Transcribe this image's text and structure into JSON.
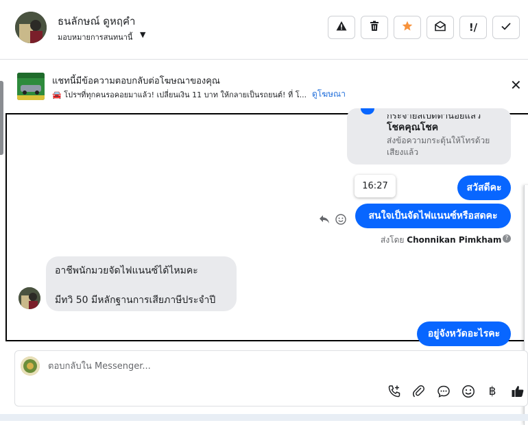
{
  "header": {
    "contact_name": "ธนลักษณ์ ดูหฤคำ",
    "assign_label": "มอบหมายการสนทนานี้",
    "buttons": [
      {
        "name": "spam-button",
        "icon": "warning-icon"
      },
      {
        "name": "delete-button",
        "icon": "trash-icon"
      },
      {
        "name": "star-button",
        "icon": "star-icon"
      },
      {
        "name": "mark-unread-button",
        "icon": "envelope-open-icon"
      },
      {
        "name": "follow-up-button",
        "icon": "double-exclamation-icon"
      },
      {
        "name": "done-button",
        "icon": "check-icon"
      }
    ]
  },
  "ad_banner": {
    "title": "แชทนี้มีข้อความตอบกลับต่อโฆษณาของคุณ",
    "description": "🚘 โปรฯที่ทุกคนรอคอยมาแล้ว! เปลี่ยนเงิน 11 บาท ให้กลายเป็นรถยนต์! ที่ โ...",
    "link": "ดูโฆษณา"
  },
  "chat": {
    "previous_card": {
      "line1": "กระจายสเปิดตำน้อยแล้ว",
      "line2": "โชคคุณโชค",
      "line3": "ส่งข้อความกระตุ้นให้โทรด้วย",
      "line4": "เสียงแล้ว"
    },
    "time_tooltip": "16:27",
    "outgoing": [
      "สวัสดีคะ",
      "สนใจเป็นจัดไฟแนนซ์หรือสดคะ",
      "อยู่จังหวัดอะไรคะ"
    ],
    "sent_by_prefix": "ส่งโดย",
    "sent_by_name": "Chonnikan Pimkham",
    "incoming": {
      "line1": "อาชีพนักมวยจัดไฟแนนซ์ได้ไหมคะ",
      "line2": "มีทวิ 50  มีหลักฐานการเสียภาษีประจำปี"
    }
  },
  "composer": {
    "placeholder": "ตอบกลับใน Messenger...",
    "icons": [
      "call-add-icon",
      "attachment-icon",
      "saved-reply-icon",
      "emoji-icon",
      "baht-icon",
      "like-icon"
    ]
  },
  "colors": {
    "accent": "#0866ff",
    "star": "#f7923b",
    "incoming_bubble": "#e9eaed"
  }
}
